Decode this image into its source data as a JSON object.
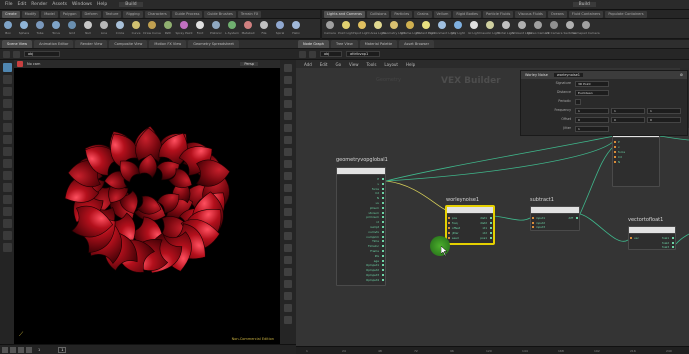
{
  "menubar": {
    "items": [
      "File",
      "Edit",
      "Render",
      "Assets",
      "Windows",
      "Help"
    ],
    "desktop": "Build",
    "right_desktop": "Build"
  },
  "shelf_tabs_left": [
    "Create",
    "Modify",
    "Model",
    "Polygon",
    "Deform",
    "Texture",
    "Rigging",
    "Characters",
    "Guide Process",
    "Guide Brushes",
    "Terrain FX"
  ],
  "shelf_tabs_right": [
    "Lights and Cameras",
    "Collisions",
    "Particles",
    "Grains",
    "Vellum",
    "Rigid Bodies",
    "Particle Fluids",
    "Viscous Fluids",
    "Oceans",
    "Fluid Containers",
    "Populate Containers"
  ],
  "tools_left": [
    {
      "label": "Box",
      "color": "#7fa4c8"
    },
    {
      "label": "Sphere",
      "color": "#8fb4d6"
    },
    {
      "label": "Tube",
      "color": "#7a98bb"
    },
    {
      "label": "Torus",
      "color": "#7fa4c8"
    },
    {
      "label": "Grid",
      "color": "#6a8fb0"
    },
    {
      "label": "Null",
      "color": "#c8c8c8"
    },
    {
      "label": "Line",
      "color": "#b8b8b8"
    },
    {
      "label": "Circle",
      "color": "#a8c0d8"
    },
    {
      "label": "Curve",
      "color": "#d0c070"
    },
    {
      "label": "Draw Curve",
      "color": "#c0a050"
    },
    {
      "label": "Path",
      "color": "#90b070"
    },
    {
      "label": "Spray Paint",
      "color": "#c070c0"
    },
    {
      "label": "Font",
      "color": "#e0e0e0"
    },
    {
      "label": "Platonic",
      "color": "#8fa8c0"
    },
    {
      "label": "L-System",
      "color": "#70b070"
    },
    {
      "label": "Metaball",
      "color": "#d08080"
    },
    {
      "label": "File",
      "color": "#c0c0c0"
    },
    {
      "label": "Spiral",
      "color": "#90a8d0"
    },
    {
      "label": "Helix",
      "color": "#a0b8d8"
    }
  ],
  "tools_right": [
    {
      "label": "Camera",
      "color": "#a0a0a0"
    },
    {
      "label": "Point Light",
      "color": "#e0d070"
    },
    {
      "label": "Spot Light",
      "color": "#e0c060"
    },
    {
      "label": "Area Light",
      "color": "#e0d890"
    },
    {
      "label": "Geometry Light",
      "color": "#d8c070"
    },
    {
      "label": "Volume Light",
      "color": "#d0b050"
    },
    {
      "label": "Distant Light",
      "color": "#e8e080"
    },
    {
      "label": "Environment Light",
      "color": "#a0c0e0"
    },
    {
      "label": "Sky Light",
      "color": "#7fb0e0"
    },
    {
      "label": "GI Light",
      "color": "#e0e0e0"
    },
    {
      "label": "Caustic Light",
      "color": "#d0d0a0"
    },
    {
      "label": "Portal Light",
      "color": "#c0c0c0"
    },
    {
      "label": "Ambient Light",
      "color": "#b0b0b0"
    },
    {
      "label": "Stereo Camera",
      "color": "#a0a0a0"
    },
    {
      "label": "VR Camera",
      "color": "#909090"
    },
    {
      "label": "Switcher",
      "color": "#b0b0b0"
    },
    {
      "label": "Gamepad Camera",
      "color": "#a0a0a0"
    }
  ],
  "left_pane": {
    "tabs": [
      "Scene View",
      "Animation Editor",
      "Render View",
      "Composite View",
      "Motion FX View",
      "Geometry Spreadsheet"
    ],
    "path": "obj",
    "viewport_label": "Persp",
    "viewport_cam": "No cam",
    "viewport_status": "Non-Commercial Edition",
    "timeline_frame": "1",
    "timeline_start": "1"
  },
  "right_pane": {
    "tabs": [
      "Node Graph",
      "Tree View",
      "Material Palette",
      "Asset Browser"
    ],
    "path": "obj",
    "path2": "attribvop1",
    "menu": [
      "Add",
      "Edit",
      "Go",
      "View",
      "Tools",
      "Layout",
      "Help"
    ],
    "context_label": "VEX Builder",
    "context_sub": "Geometry"
  },
  "nodes": [
    {
      "name": "geometryvopglobal1",
      "inputs": [],
      "outputs": [
        "P",
        "v",
        "force",
        "Cd",
        "N",
        "uv",
        "ptnum",
        "vtxnum",
        "primnum",
        "id",
        "numpt",
        "numvtx",
        "numprim",
        "Time",
        "TimeInc",
        "Frame",
        "life",
        "age",
        "OpInput1",
        "OpInput2",
        "OpInput3",
        "OpInput4"
      ]
    },
    {
      "name": "worleynoise1",
      "inputs": [
        "pos",
        "freq",
        "offset",
        "jitter",
        "seed"
      ],
      "outputs": [
        "dist1",
        "dist2",
        "id1",
        "id2",
        "pos1"
      ]
    },
    {
      "name": "subtract1",
      "inputs": [
        "input1",
        "input2",
        "input3"
      ],
      "outputs": [
        "diff"
      ]
    },
    {
      "name": "vectortofloat1",
      "inputs": [
        "vec"
      ],
      "outputs": [
        "fval1",
        "fval2",
        "fval3"
      ]
    },
    {
      "name": "geometryvopoutput1",
      "inputs": [
        "P",
        "v",
        "force",
        "Cd",
        "N"
      ],
      "outputs": []
    }
  ],
  "parms": {
    "title": "Worley Noise",
    "node": "worleynoise1",
    "rows": [
      {
        "label": "Signature",
        "value": "3D Point"
      },
      {
        "label": "Distance",
        "value": "Euclidean"
      },
      {
        "label": "Periodic",
        "value": ""
      },
      {
        "label": "Frequency",
        "values": [
          "1",
          "1",
          "1"
        ]
      },
      {
        "label": "Offset",
        "values": [
          "0",
          "0",
          "0"
        ]
      },
      {
        "label": "Jitter",
        "value": "1"
      }
    ]
  },
  "ruler_ticks": [
    "1",
    "24",
    "48",
    "72",
    "96",
    "120",
    "144",
    "168",
    "192",
    "216",
    "240"
  ],
  "colors": {
    "wire_green": "#3fb88c",
    "wire_yellow": "#d9d15a",
    "selection": "#e5d000",
    "shape": "#8b0a12"
  }
}
